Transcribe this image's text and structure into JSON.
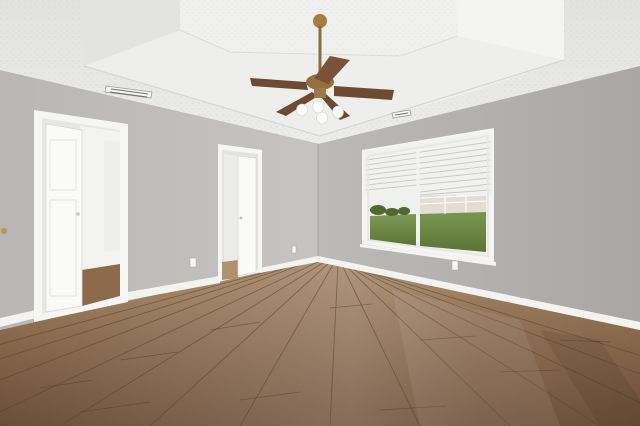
{
  "scene": {
    "subject": "empty-room-photo",
    "colors": {
      "ceiling": "#e9e9e7",
      "tray_ceiling": "#f1f1ef",
      "wall_left": "#bfbdbc",
      "wall_right": "#b3b1b1",
      "wall_back": "#c4c2c1",
      "baseboard": "#f4f4f2",
      "door_trim": "#f6f6f4",
      "floor_light": "#8a6a4e",
      "floor_dark": "#5e4330",
      "fan_brown": "#6e4a33",
      "fan_brass": "#a57d44",
      "window_glass_sky": "#f5f7f6",
      "window_lawn": "#5f7a3c"
    },
    "icons": {
      "ceiling_fan": "ceiling-fan-icon",
      "air_vent": "vent-icon",
      "wall_outlet": "outlet-icon"
    }
  }
}
